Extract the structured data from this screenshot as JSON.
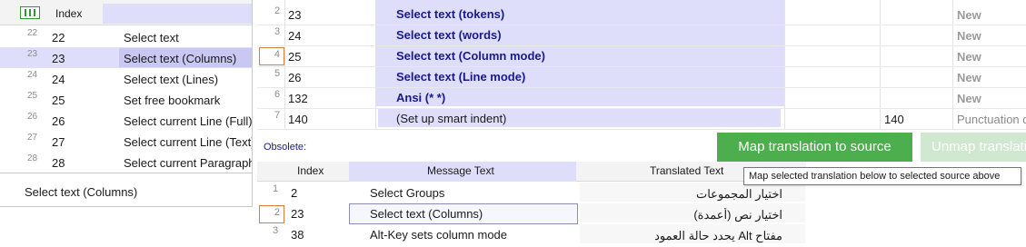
{
  "left_panel": {
    "header": {
      "index": "Index"
    },
    "rows": [
      {
        "line": "22",
        "index": "22",
        "text": "Select text"
      },
      {
        "line": "23",
        "index": "23",
        "text": "Select text (Columns)"
      },
      {
        "line": "24",
        "index": "24",
        "text": "Select text (Lines)"
      },
      {
        "line": "25",
        "index": "25",
        "text": "Set free bookmark"
      },
      {
        "line": "26",
        "index": "26",
        "text": "Select current Line (Full)"
      },
      {
        "line": "27",
        "index": "27",
        "text": "Select current Line (Text)"
      },
      {
        "line": "28",
        "index": "28",
        "text": "Select current Paragraph"
      }
    ],
    "status_text": "Select text (Columns)"
  },
  "main_grid": {
    "rows": [
      {
        "line": "2",
        "index": "23",
        "message": "Select text (tokens)",
        "translation": "",
        "status": "New"
      },
      {
        "line": "3",
        "index": "24",
        "message": "Select text (words)",
        "translation": "",
        "status": "New"
      },
      {
        "line": "4",
        "index": "25",
        "message": "Select text (Column mode)",
        "translation": "",
        "status": "New"
      },
      {
        "line": "5",
        "index": "26",
        "message": "Select text (Line mode)",
        "translation": "",
        "status": "New"
      },
      {
        "line": "6",
        "index": "132",
        "message": "Ansi (* *)",
        "translation": "",
        "status": "New"
      },
      {
        "line": "7",
        "index": "140",
        "message": "(Set up smart indent)",
        "translation": "140",
        "status": "Punctuation d"
      }
    ]
  },
  "obsolete": {
    "label": "Obsolete:",
    "map_button": "Map translation to source",
    "unmap_button": "Unmap translati",
    "tooltip": "Map selected translation below to selected source above",
    "headers": {
      "index": "Index",
      "message": "Message Text",
      "translated": "Translated Text"
    },
    "rows": [
      {
        "line": "1",
        "index": "2",
        "message": "Select Groups",
        "translation": "اختيار المجموعات"
      },
      {
        "line": "2",
        "index": "23",
        "message": "Select text (Columns)",
        "translation": "اختيار نص (أعمدة)"
      },
      {
        "line": "3",
        "index": "38",
        "message": "Alt-Key sets column mode",
        "translation": "مفتاح Alt يحدد حالة العمود"
      }
    ]
  },
  "colors": {
    "selection": "#dedefa",
    "accent_button": "#4cae4c",
    "message_text": "#1a1a8a",
    "focus_box": "#e07a3a"
  },
  "icons": {
    "columns_toggle": "columns-icon"
  }
}
